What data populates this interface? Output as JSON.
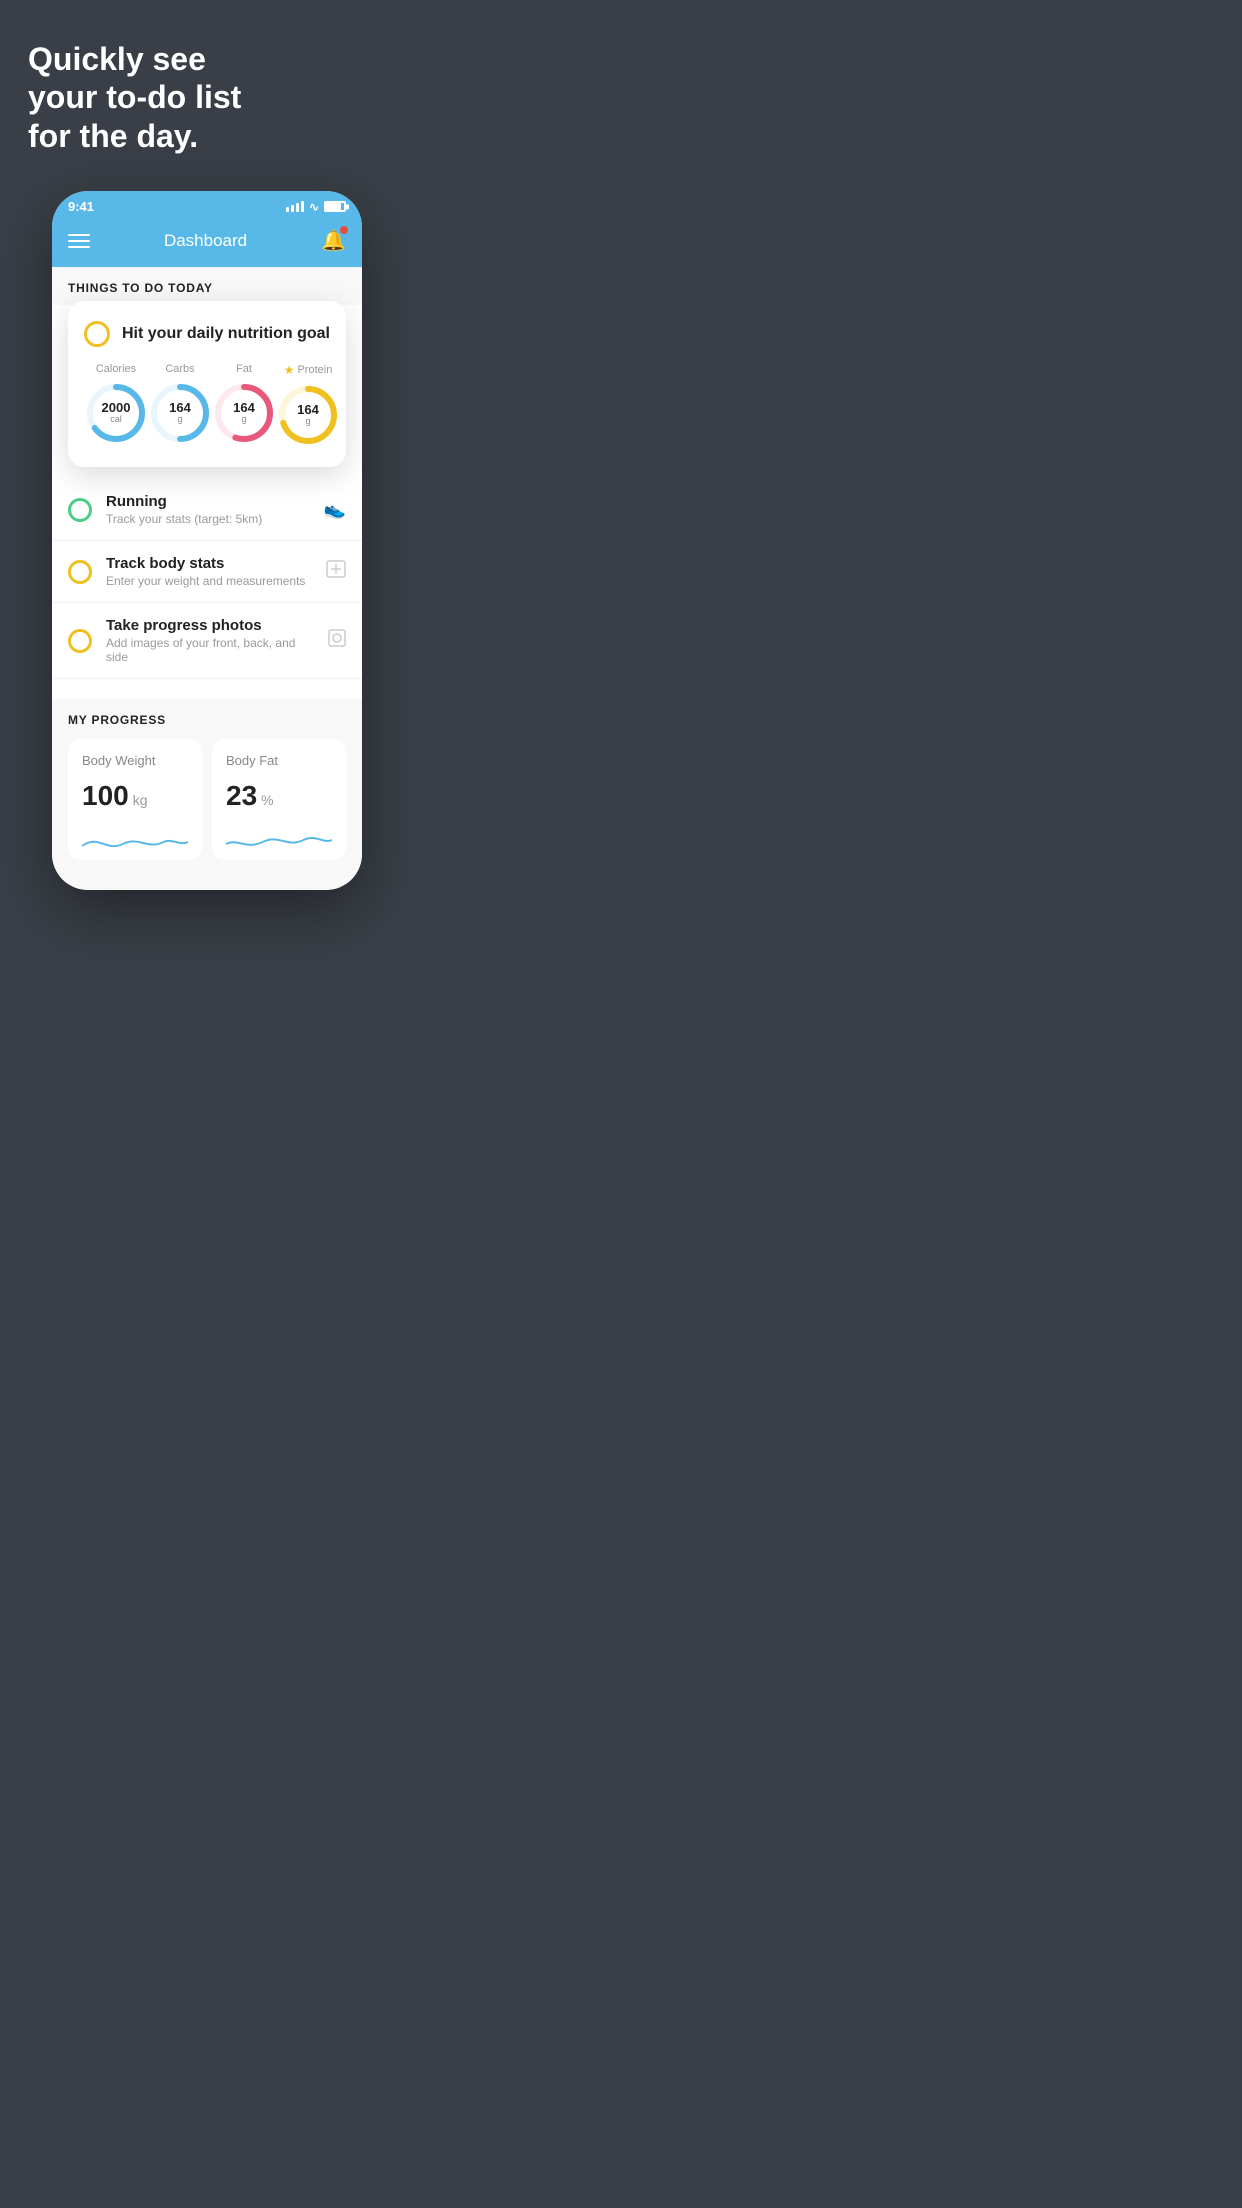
{
  "hero": {
    "text_line1": "Quickly see",
    "text_line2": "your to-do list",
    "text_line3": "for the day."
  },
  "phone": {
    "status_bar": {
      "time": "9:41"
    },
    "nav": {
      "title": "Dashboard"
    },
    "things_section": {
      "heading": "THINGS TO DO TODAY"
    },
    "floating_card": {
      "title": "Hit your daily nutrition goal",
      "nutrition": [
        {
          "label": "Calories",
          "value": "2000",
          "unit": "cal",
          "color": "#58b8e8",
          "percent": 65,
          "star": false
        },
        {
          "label": "Carbs",
          "value": "164",
          "unit": "g",
          "color": "#58b8e8",
          "percent": 50,
          "star": false
        },
        {
          "label": "Fat",
          "value": "164",
          "unit": "g",
          "color": "#e8587a",
          "percent": 55,
          "star": false
        },
        {
          "label": "Protein",
          "value": "164",
          "unit": "g",
          "color": "#f0c020",
          "percent": 70,
          "star": true
        }
      ]
    },
    "todo_items": [
      {
        "title": "Running",
        "subtitle": "Track your stats (target: 5km)",
        "circle_color": "green",
        "icon": "👟"
      },
      {
        "title": "Track body stats",
        "subtitle": "Enter your weight and measurements",
        "circle_color": "yellow",
        "icon": "⊡"
      },
      {
        "title": "Take progress photos",
        "subtitle": "Add images of your front, back, and side",
        "circle_color": "yellow",
        "icon": "👤"
      }
    ],
    "progress": {
      "heading": "MY PROGRESS",
      "cards": [
        {
          "title": "Body Weight",
          "value": "100",
          "unit": "kg"
        },
        {
          "title": "Body Fat",
          "value": "23",
          "unit": "%"
        }
      ]
    }
  }
}
